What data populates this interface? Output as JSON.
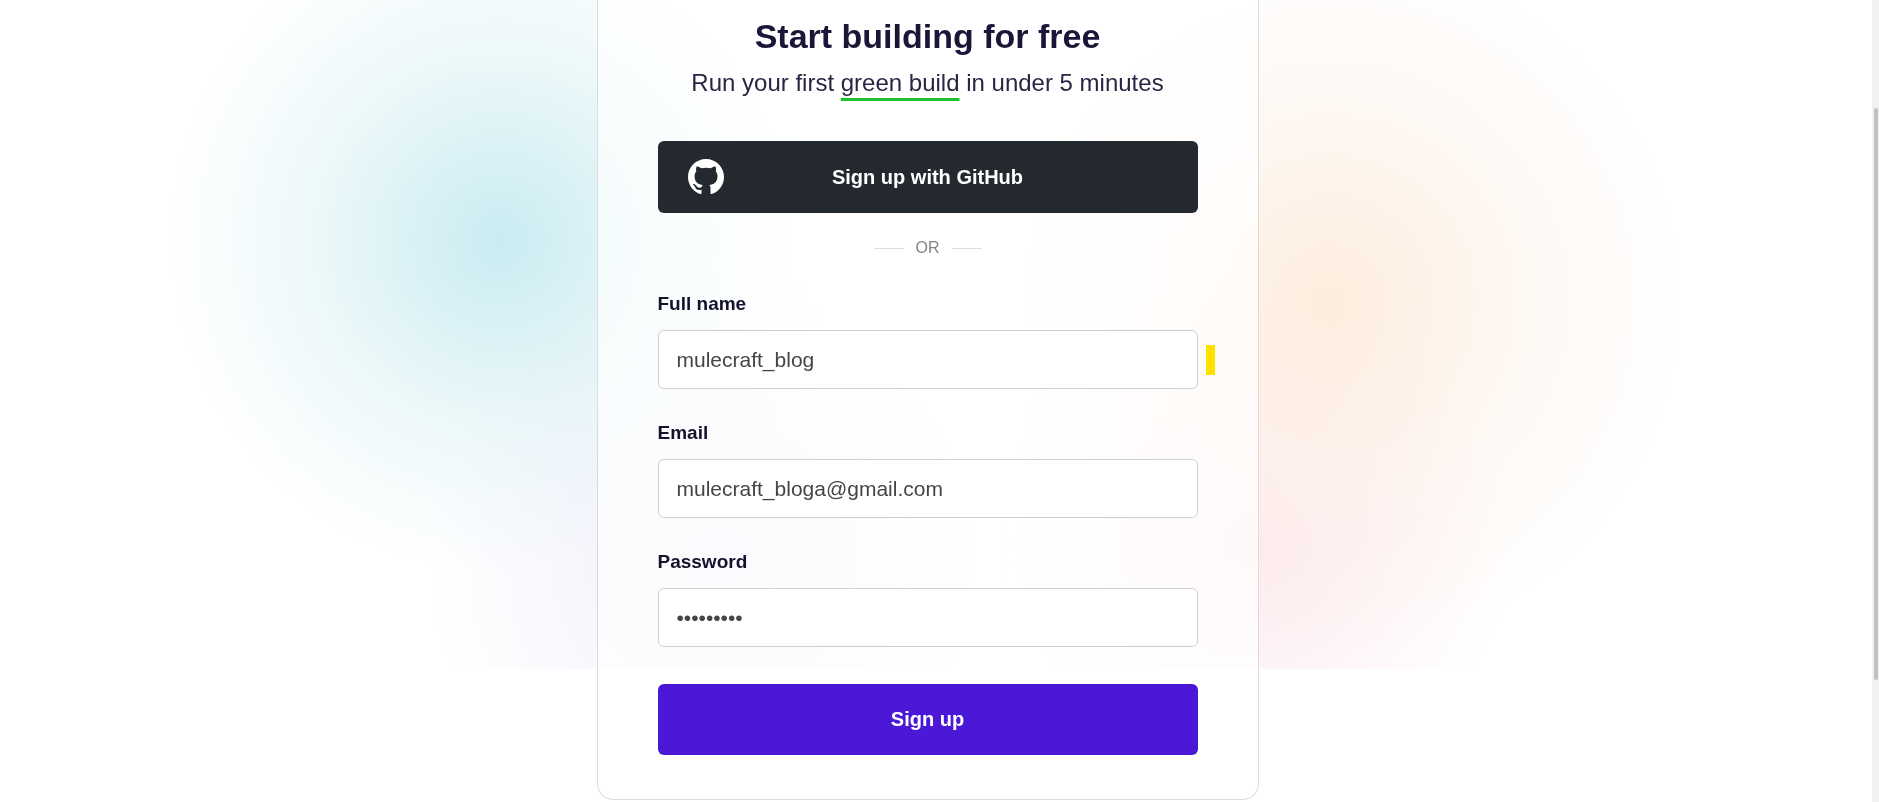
{
  "heading": {
    "title": "Start building for free",
    "subtitle": [
      {
        "text": "Run your first",
        "underlined": false
      },
      {
        "text": "green build",
        "underlined": true
      },
      {
        "text": "in under 5 minutes",
        "underlined": false
      }
    ]
  },
  "github_button": {
    "label": "Sign up with GitHub"
  },
  "divider": {
    "label": "OR"
  },
  "fields": [
    {
      "label": "Full name",
      "value": "mulecraft_blog",
      "marked": true
    },
    {
      "label": "Email",
      "value": "mulecraft_bloga@gmail.com",
      "marked": false
    },
    {
      "label": "Password",
      "value": "•••••••••",
      "marked": false
    }
  ],
  "submit_button": {
    "label": "Sign up"
  }
}
